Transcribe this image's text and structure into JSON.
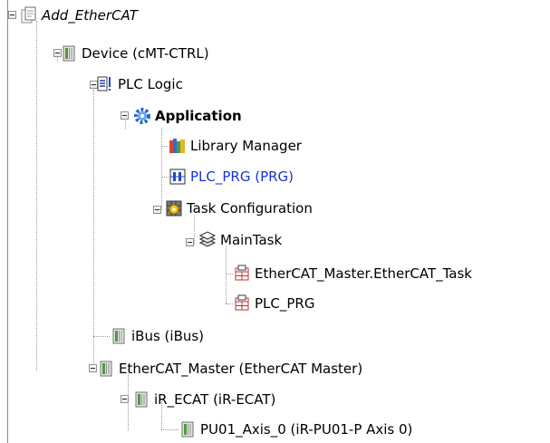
{
  "tree": {
    "project": {
      "label": "Add_EtherCAT",
      "icon": "project-page-icon"
    },
    "device": {
      "label": "Device (cMT-CTRL)",
      "icon": "device-icon"
    },
    "plc_logic": {
      "label": "PLC Logic",
      "icon": "plc-logic-icon"
    },
    "application": {
      "label": "Application",
      "icon": "application-gear-icon"
    },
    "library_manager": {
      "label": "Library Manager",
      "icon": "library-books-icon"
    },
    "plc_prg": {
      "label": "PLC_PRG (PRG)",
      "icon": "program-pou-icon",
      "color": "#1a33d6"
    },
    "task_configuration": {
      "label": "Task Configuration",
      "icon": "task-configuration-icon"
    },
    "main_task": {
      "label": "MainTask",
      "icon": "task-stack-icon"
    },
    "task_call_ethercat": {
      "label": "EtherCAT_Master.EtherCAT_Task",
      "icon": "task-call-icon"
    },
    "task_call_plc_prg": {
      "label": "PLC_PRG",
      "icon": "task-call-icon"
    },
    "ibus": {
      "label": "iBus (iBus)",
      "icon": "device-icon"
    },
    "ethercat_master": {
      "label": "EtherCAT_Master (EtherCAT Master)",
      "icon": "device-icon"
    },
    "ir_ecat": {
      "label": "iR_ECAT (iR-ECAT)",
      "icon": "device-icon"
    },
    "pu01_axis": {
      "label": "PU01_Axis_0 (iR-PU01-P Axis 0)",
      "icon": "device-icon"
    }
  }
}
